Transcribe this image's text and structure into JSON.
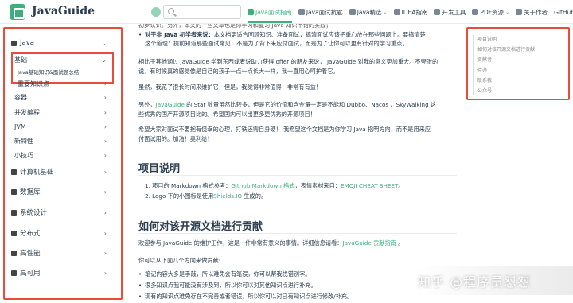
{
  "navbar": {
    "site_title": "JavaGuide",
    "search_placeholder": "",
    "links": [
      {
        "label": "Java面试指南",
        "active": true
      },
      {
        "label": "Java面试抗匙",
        "active": false
      },
      {
        "label": "Java精选",
        "active": false,
        "caret": "⌄"
      },
      {
        "label": "IDEA指南",
        "active": false
      },
      {
        "label": "开发工具",
        "active": false
      },
      {
        "label": "PDF资源",
        "active": false,
        "caret": "⌄"
      },
      {
        "label": "关于作者",
        "active": false
      },
      {
        "label": "GitHub",
        "active": false
      }
    ]
  },
  "sidebar": {
    "items": [
      {
        "label": "Java",
        "chevron": "⌄"
      },
      {
        "label": "基础",
        "chevron": "⌄"
      },
      {
        "label": "Java基础知识&面试题总结"
      },
      {
        "label": "重要知识点",
        "chevron": "›"
      },
      {
        "label": "容器",
        "chevron": "›"
      },
      {
        "label": "并发编程",
        "chevron": "›"
      },
      {
        "label": "JVM",
        "chevron": "›"
      },
      {
        "label": "新特性",
        "chevron": "›"
      },
      {
        "label": "小技巧",
        "chevron": "›"
      },
      {
        "label": "计算机基础",
        "chevron": "›"
      },
      {
        "label": "数据库",
        "chevron": "›"
      },
      {
        "label": "系统设计",
        "chevron": "›"
      },
      {
        "label": "分布式",
        "chevron": "›"
      },
      {
        "label": "高性能",
        "chevron": "›"
      },
      {
        "label": "高可用",
        "chevron": "›"
      }
    ]
  },
  "content": {
    "top_line": "初步认识。另外，本文的一些文章也是你学习和复习 Java 知识不错的实践；",
    "bullet_1_bold": "对于非 Java 初学者来说：",
    "bullet_1_text": "本文档更适合回顾知识、准备面试，搞清面试应该把重心放在那些问题上。要搞清楚",
    "bullet_1_cont": "这个道理：提前知道那些面试常见，不是为了背下来应付面试，而是为了让你可以更有针对的学习重点。",
    "para_2": "相比于其他通过 JavaGuide 学到东西或者说助力获得 offer 的朋友来说， JavaGuide 对我的意义更加重大。不夸张的",
    "para_2_cont": "说，有时候真的感觉像是自己的孩子一点一点长大一样，我一直用心呵护着它。",
    "para_3": "虽然，我花了很长时间来维护它，但是，我觉得非常值得！非常有有益！",
    "para_4_a": "另外，",
    "para_4_link": "JavaGuide",
    "para_4_b": " 的 Star 数量虽然比较多，但是它的价值和含金量一定是不能和 Dubbo、Nacos 、SkyWalking 这",
    "para_4_cont": "些优秀的国产开源项目比的。希望国内可以出更多更优秀的开源项目！",
    "para_5": "希望大家对面试不要抱有侥幸的心理，打铁还需自身硬！ 我希望这个文档是为你学习 Java 指明方向，而不是用来应",
    "para_5_cont": "付面试用的。加油！奥利给！",
    "h2_project": "项目说明",
    "proj_1_a": "1. 项目的 Markdown 格式参考：",
    "proj_1_link1": "Github Markdown 格式",
    "proj_1_b": "，表情素材来自：",
    "proj_1_link2": "EMOJI CHEAT SHEET",
    "proj_1_c": "。",
    "proj_2_a": "2. Logo 下的小图标是使用",
    "proj_2_link": "Shields.IO",
    "proj_2_b": " 生成的。",
    "h2_contrib": "如何对该开源文档进行贡献",
    "contrib_a": "欢迎参与 JavaGuide 的维护工作，这是一件非常有意义的事情。详细信息请看：",
    "contrib_link": "JavaGuide 贡献指南",
    "contrib_b": " 。",
    "contrib_p2": "你可以从下面几个方向来做贡献:",
    "contrib_li_1": "笔记内容大多是手敲，所以难免会有笔误，你可以帮我找错别字。",
    "contrib_li_2": "很多知识点我可能没有涉及到，所以你可以对其他知识点进行补充。",
    "contrib_li_3": "现有的知识点难免存在不完善或者错误，所以你可以对已有知识点进行修改/补充。"
  },
  "toc": {
    "items": [
      "项目说明",
      "如何对该开源文档进行贡献",
      "贡献者",
      "待办",
      "联系我",
      "公众号"
    ]
  },
  "watermark": {
    "text": "知乎 @程序员怼怼"
  }
}
